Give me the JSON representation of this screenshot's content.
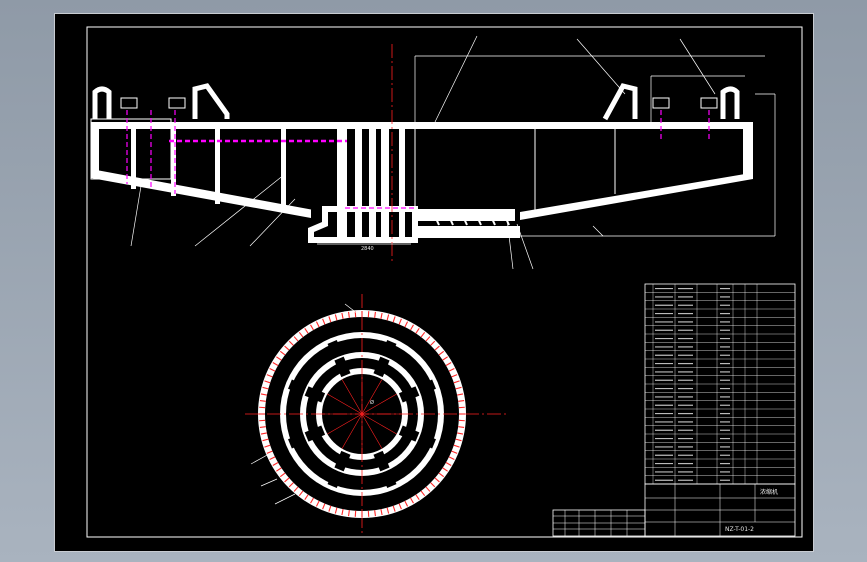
{
  "drawing": {
    "colors": {
      "paper": "#000000",
      "lines": "#ffffff",
      "hidden": "#ff00ff",
      "center": "#ff2020",
      "gear_teeth": "#ff2828"
    },
    "elevation_view": {
      "dimension_label": "2840"
    },
    "plan_view": {
      "ring_label": "Ø"
    },
    "parts_list": {
      "rows": 24
    },
    "title_block": {
      "name": "浓缩机",
      "code": "NZ-T-01-2"
    }
  }
}
